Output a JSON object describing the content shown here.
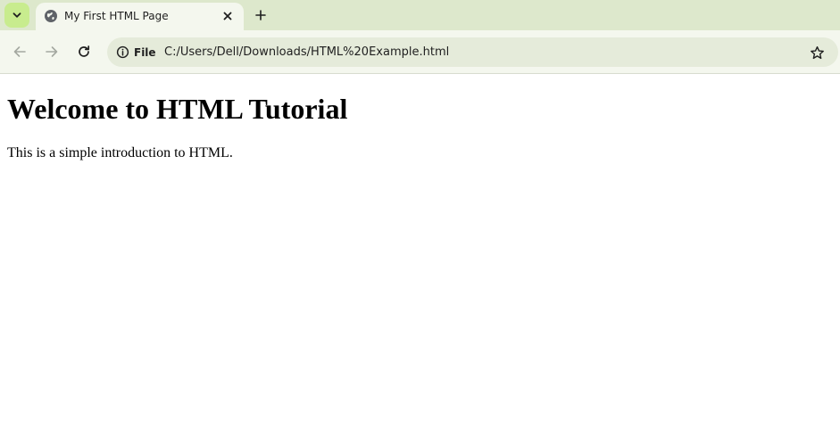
{
  "browser": {
    "tab": {
      "title": "My First HTML Page",
      "favicon": "globe-icon"
    },
    "address_bar": {
      "site_info_label": "File",
      "url": "C:/Users/Dell/Downloads/HTML%20Example.html"
    },
    "colors": {
      "tabstrip_bg": "#dde8cc",
      "active_tab_bg": "#f4f7ee",
      "tab_search_bg": "#c8ec8e",
      "omnibox_bg": "#e5ebda"
    }
  },
  "page": {
    "heading": "Welcome to HTML Tutorial",
    "paragraph": "This is a simple introduction to HTML."
  }
}
